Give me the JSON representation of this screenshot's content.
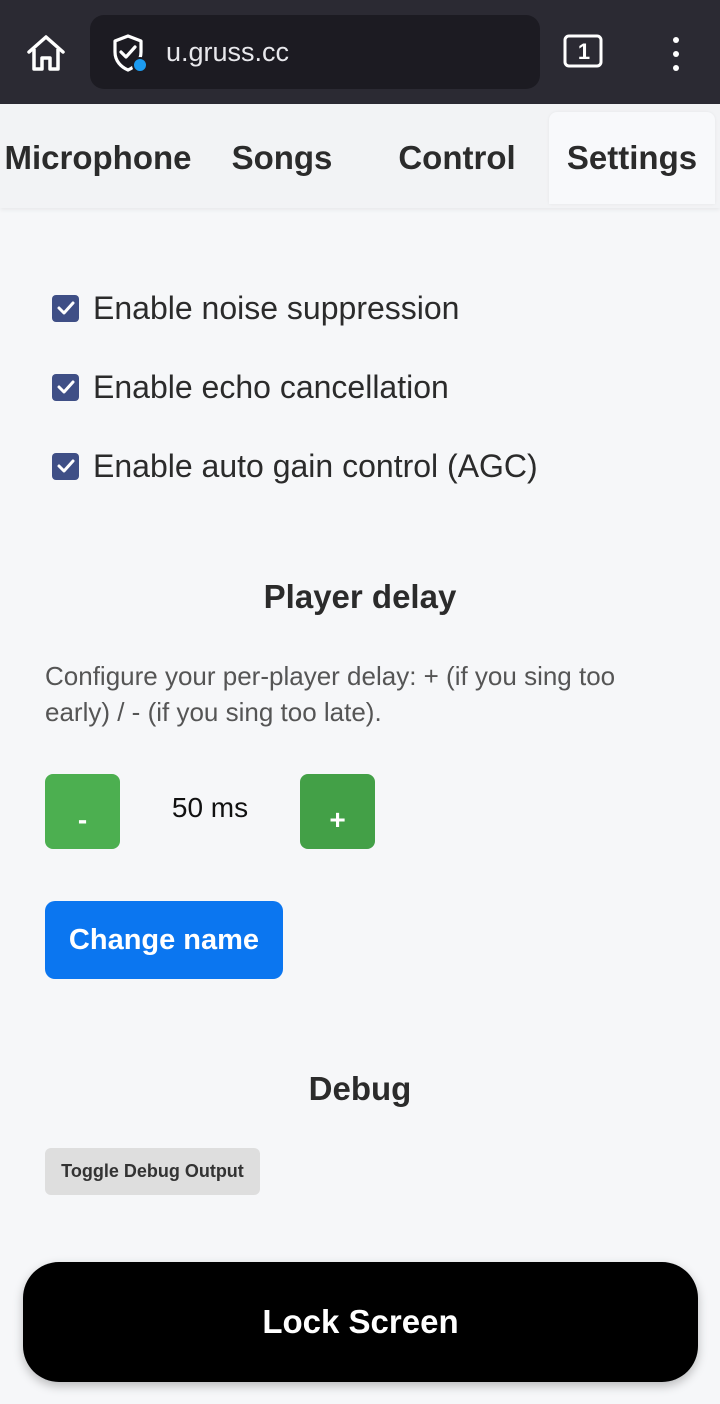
{
  "browser": {
    "url": "u.gruss.cc",
    "tab_count": "1",
    "icons": [
      "home-icon",
      "shield-check-icon",
      "tabs-icon",
      "more-vert-icon"
    ]
  },
  "tabs": [
    {
      "label": "Microphone",
      "active": false
    },
    {
      "label": "Songs",
      "active": false
    },
    {
      "label": "Control",
      "active": false
    },
    {
      "label": "Settings",
      "active": true
    }
  ],
  "settings": {
    "checkboxes": [
      {
        "label": "Enable noise suppression",
        "checked": true
      },
      {
        "label": "Enable echo cancellation",
        "checked": true
      },
      {
        "label": "Enable auto gain control (AGC)",
        "checked": true
      }
    ],
    "player_delay": {
      "title": "Player delay",
      "description": "Configure your per-player delay: + (if you sing too early) / - (if you sing too late).",
      "minus_label": "-",
      "plus_label": "+",
      "value": "50 ms"
    },
    "change_name_label": "Change name",
    "debug": {
      "title": "Debug",
      "toggle_label": "Toggle Debug Output"
    }
  },
  "lock_screen_label": "Lock Screen",
  "colors": {
    "browser_bg": "#2b2a33",
    "checkbox": "#3f4f86",
    "green": "#4caf50",
    "blue": "#0b76f0",
    "lock_bg": "#000000"
  }
}
